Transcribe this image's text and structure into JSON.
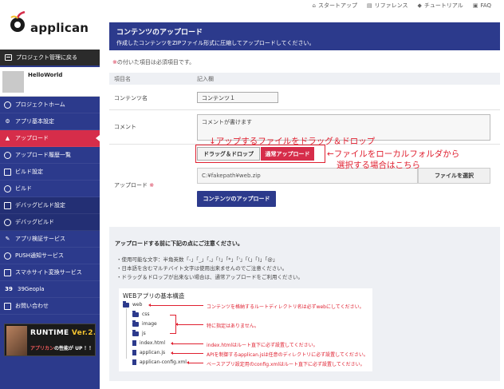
{
  "brand": {
    "logo_text": "applican"
  },
  "sidebar": {
    "back_label": "プロジェクト管理に戻る",
    "project_name": "HelloWorld",
    "items": [
      {
        "label": "プロジェクトホーム",
        "icon": "home-icon"
      },
      {
        "label": "アプリ基本設定",
        "icon": "gear-icon"
      },
      {
        "label": "アップロード",
        "icon": "upload-icon",
        "active": true
      },
      {
        "label": "アップロード履歴一覧",
        "icon": "history-icon"
      },
      {
        "label": "ビルド設定",
        "icon": "build-settings-icon"
      },
      {
        "label": "ビルド",
        "icon": "build-icon"
      },
      {
        "label": "デバッグビルド設定",
        "icon": "debug-settings-icon"
      },
      {
        "label": "デバッグビルド",
        "icon": "debug-build-icon"
      },
      {
        "label": "アプリ検証サービス",
        "icon": "wrench-icon"
      },
      {
        "label": "PUSH通知サービス",
        "icon": "push-icon"
      },
      {
        "label": "スマホサイト変換サービス",
        "icon": "convert-icon"
      },
      {
        "label": "39Geopla",
        "icon": "geopla-icon"
      },
      {
        "label": "お問い合わせ",
        "icon": "mail-icon"
      }
    ],
    "banner": {
      "title_a": "RUNTIME ",
      "title_b": "Ver.2.0",
      "sub_a": "アプリカン",
      "sub_b": "の性能が UP ！！"
    }
  },
  "topnav": {
    "items": [
      "スタートアップ",
      "リファレンス",
      "チュートリアル",
      "FAQ"
    ]
  },
  "page": {
    "title": "コンテンツのアップロード",
    "description": "作成したコンテンツをZIPファイル形式に圧縮してアップロードしてください。",
    "required_mark": "※",
    "required_note": "の付いた項目は必須項目です。"
  },
  "form": {
    "col_item": "項目名",
    "col_entry": "記入欄",
    "content_name_label": "コンテンツ名",
    "content_name_value": "コンテンツ１",
    "comment_label": "コメント",
    "comment_placeholder": "コメントが書けます",
    "upload_label": "アップロード",
    "required_mark": "※",
    "tab_drag": "ドラッグ＆ドロップ",
    "tab_normal": "通常アップロード",
    "file_path": "C:¥fakepath¥web.zip",
    "file_button": "ファイルを選択",
    "submit_button": "コンテンツのアップロード"
  },
  "annotations": {
    "drag_note": "↓アップするファイルをドラッグ＆ドロップ",
    "local_note_1": "←ファイルをローカルフォルダから",
    "local_note_2": "選択する場合はこちら"
  },
  "notes": {
    "title": "アップロードする前に下記の点にご注意ください。",
    "lines": [
      "・使用可能な文字：半角英数「-」「_」「,」「!」「*」「'」「(」「)」「@」",
      "・日本語を含むマルチバイト文字は使用出来ませんのでご注意ください。",
      "・ドラッグ＆ドロップが出来ない場合は、通常アップロードをご利用ください。"
    ],
    "structure_title": "WEBアプリの基本構造",
    "tree": {
      "web": "web",
      "css": "css",
      "image": "image",
      "js": "js",
      "index": "index.html",
      "applican_js": "applican.js",
      "config": "applican-config.xml"
    },
    "tree_notes": {
      "web": "コンテンツを格納するルートディレクトリ名は必ずwebにしてください。",
      "folders": "特に指定はありません。",
      "index": "index.htmlはルート直下に必ず設置してください。",
      "applican_js": "APIを制御するapplican.jsは任意のディレクトリに必ず設置してください。",
      "config": "ベースアプリ設定用のconfig.xmlはルート直下に必ず設置してください。"
    }
  }
}
